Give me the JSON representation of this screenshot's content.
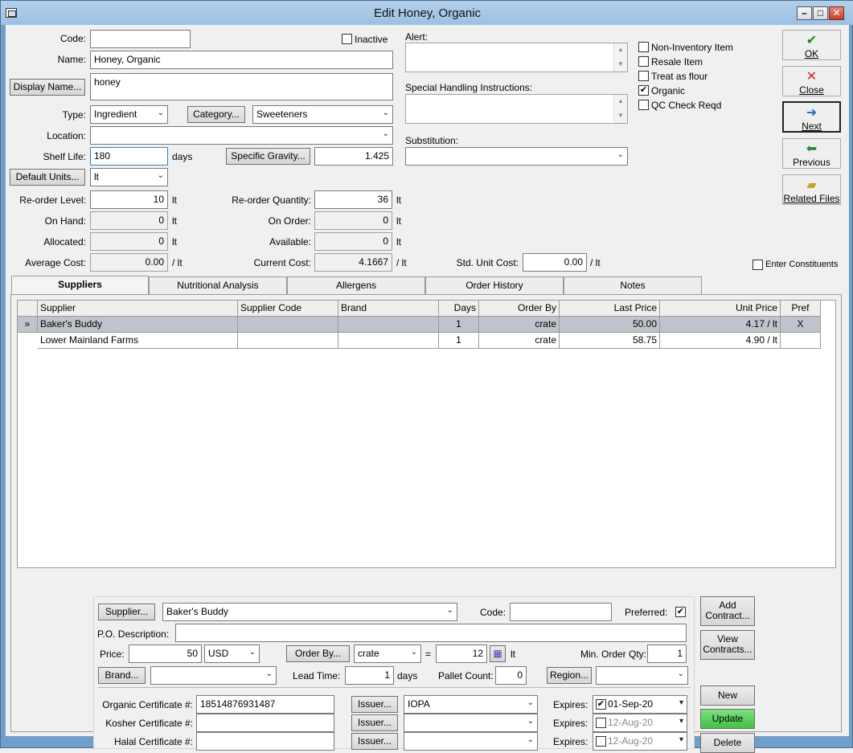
{
  "window": {
    "title": "Edit Honey, Organic"
  },
  "form": {
    "code_label": "Code:",
    "code_value": "",
    "inactive_label": "Inactive",
    "inactive_checked": false,
    "name_label": "Name:",
    "name_value": "Honey, Organic",
    "display_name_button": "Display Name...",
    "display_name_value": "honey",
    "type_label": "Type:",
    "type_value": "Ingredient",
    "category_button": "Category...",
    "category_value": "Sweeteners",
    "location_label": "Location:",
    "location_value": "",
    "shelf_life_label": "Shelf Life:",
    "shelf_life_value": "180",
    "shelf_life_unit": "days",
    "specific_gravity_button": "Specific Gravity...",
    "specific_gravity_value": "1.425",
    "default_units_button": "Default Units...",
    "default_units_value": "lt",
    "reorder_level_label": "Re-order Level:",
    "reorder_level_value": "10",
    "reorder_level_unit": "lt",
    "reorder_qty_label": "Re-order Quantity:",
    "reorder_qty_value": "36",
    "reorder_qty_unit": "lt",
    "on_hand_label": "On Hand:",
    "on_hand_value": "0",
    "on_hand_unit": "lt",
    "on_order_label": "On Order:",
    "on_order_value": "0",
    "on_order_unit": "lt",
    "allocated_label": "Allocated:",
    "allocated_value": "0",
    "allocated_unit": "lt",
    "available_label": "Available:",
    "available_value": "0",
    "available_unit": "lt",
    "avg_cost_label": "Average Cost:",
    "avg_cost_value": "0.00",
    "avg_cost_unit": "/ lt",
    "current_cost_label": "Current Cost:",
    "current_cost_value": "4.1667",
    "current_cost_unit": "/ lt",
    "std_unit_cost_label": "Std. Unit Cost:",
    "std_unit_cost_value": "0.00",
    "std_unit_cost_unit": "/ lt",
    "alert_label": "Alert:",
    "alert_value": "",
    "special_handling_label": "Special Handling Instructions:",
    "special_handling_value": "",
    "substitution_label": "Substitution:",
    "substitution_value": "",
    "enter_constituents_label": "Enter Constituents"
  },
  "flags": [
    {
      "label": "Non-Inventory Item",
      "checked": false
    },
    {
      "label": "Resale Item",
      "checked": false
    },
    {
      "label": "Treat as flour",
      "checked": false
    },
    {
      "label": "Organic",
      "checked": true
    },
    {
      "label": "QC Check Reqd",
      "checked": false
    }
  ],
  "side_buttons": [
    {
      "label": "OK",
      "icon": "check-icon"
    },
    {
      "label": "Close",
      "icon": "close-icon"
    },
    {
      "label": "Next",
      "icon": "next-icon"
    },
    {
      "label": "Previous",
      "icon": "previous-icon"
    },
    {
      "label": "Related Files",
      "icon": "folder-icon"
    }
  ],
  "tabs": [
    "Suppliers",
    "Nutritional Analysis",
    "Allergens",
    "Order History",
    "Notes"
  ],
  "suppliers_table": {
    "columns": [
      "Supplier",
      "Supplier Code",
      "Brand",
      "Days",
      "Order By",
      "Last Price",
      "Unit Price",
      "Pref"
    ],
    "rows": [
      {
        "marker": "»",
        "supplier": "Baker's Buddy",
        "code": "",
        "brand": "",
        "days": "1",
        "order_by": "crate",
        "last_price": "50.00",
        "unit_price": "4.17 / lt",
        "pref": "X"
      },
      {
        "marker": "",
        "supplier": "Lower Mainland Farms",
        "code": "",
        "brand": "",
        "days": "1",
        "order_by": "crate",
        "last_price": "58.75",
        "unit_price": "4.90 / lt",
        "pref": ""
      }
    ]
  },
  "detail": {
    "supplier_button": "Supplier...",
    "supplier_value": "Baker's Buddy",
    "code_label": "Code:",
    "code_value": "",
    "preferred_label": "Preferred:",
    "preferred_checked": true,
    "po_desc_label": "P.O. Description:",
    "po_desc_value": "",
    "price_label": "Price:",
    "price_value": "50",
    "currency_value": "USD",
    "order_by_button": "Order By...",
    "order_by_value": "crate",
    "equals": "=",
    "qty_value": "12",
    "qty_unit": "lt",
    "min_order_label": "Min. Order Qty:",
    "min_order_value": "1",
    "brand_button": "Brand...",
    "brand_value": "",
    "lead_time_label": "Lead Time:",
    "lead_time_value": "1",
    "lead_time_unit": "days",
    "pallet_count_label": "Pallet Count:",
    "pallet_count_value": "0",
    "region_button": "Region...",
    "region_value": "",
    "certs": [
      {
        "label": "Organic Certificate #:",
        "value": "18514876931487",
        "issuer_button": "Issuer...",
        "issuer_value": "IOPA",
        "expires_label": "Expires:",
        "expires_value": "01-Sep-20",
        "expires_checked": true
      },
      {
        "label": "Kosher Certificate #:",
        "value": "",
        "issuer_button": "Issuer...",
        "issuer_value": "",
        "expires_label": "Expires:",
        "expires_value": "12-Aug-20",
        "expires_checked": false
      },
      {
        "label": "Halal Certificate #:",
        "value": "",
        "issuer_button": "Issuer...",
        "issuer_value": "",
        "expires_label": "Expires:",
        "expires_value": "12-Aug-20",
        "expires_checked": false
      }
    ]
  },
  "detail_buttons": {
    "add_contract": "Add Contract...",
    "view_contracts": "View Contracts...",
    "new": "New",
    "update": "Update",
    "delete": "Delete"
  }
}
